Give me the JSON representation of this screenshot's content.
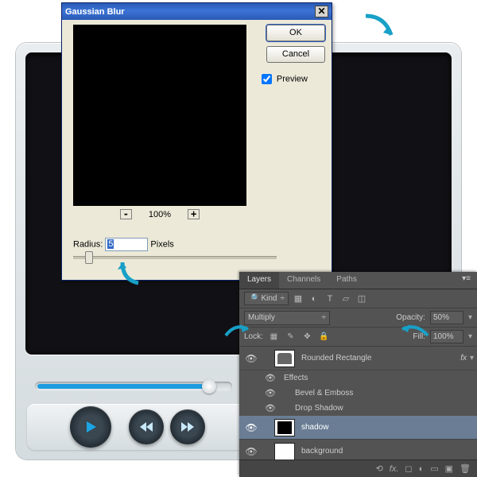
{
  "dialog": {
    "title": "Gaussian Blur",
    "ok": "OK",
    "cancel": "Cancel",
    "preview_label": "Preview",
    "preview_checked": true,
    "zoom": "100%",
    "radius_label": "Radius:",
    "radius_value": "5",
    "radius_unit": "Pixels"
  },
  "panel": {
    "tabs": [
      "Layers",
      "Channels",
      "Paths"
    ],
    "filter_kind": "Kind",
    "blend_mode": "Multiply",
    "opacity_label": "Opacity:",
    "opacity": "50%",
    "lock_label": "Lock:",
    "fill_label": "Fill:",
    "fill": "100%",
    "layers": {
      "l0": "Rounded Rectangle",
      "l0_fx": "fx",
      "l0_effects": "Effects",
      "l0_e1": "Bevel & Emboss",
      "l0_e2": "Drop Shadow",
      "l1": "shadow",
      "l2": "background"
    }
  }
}
